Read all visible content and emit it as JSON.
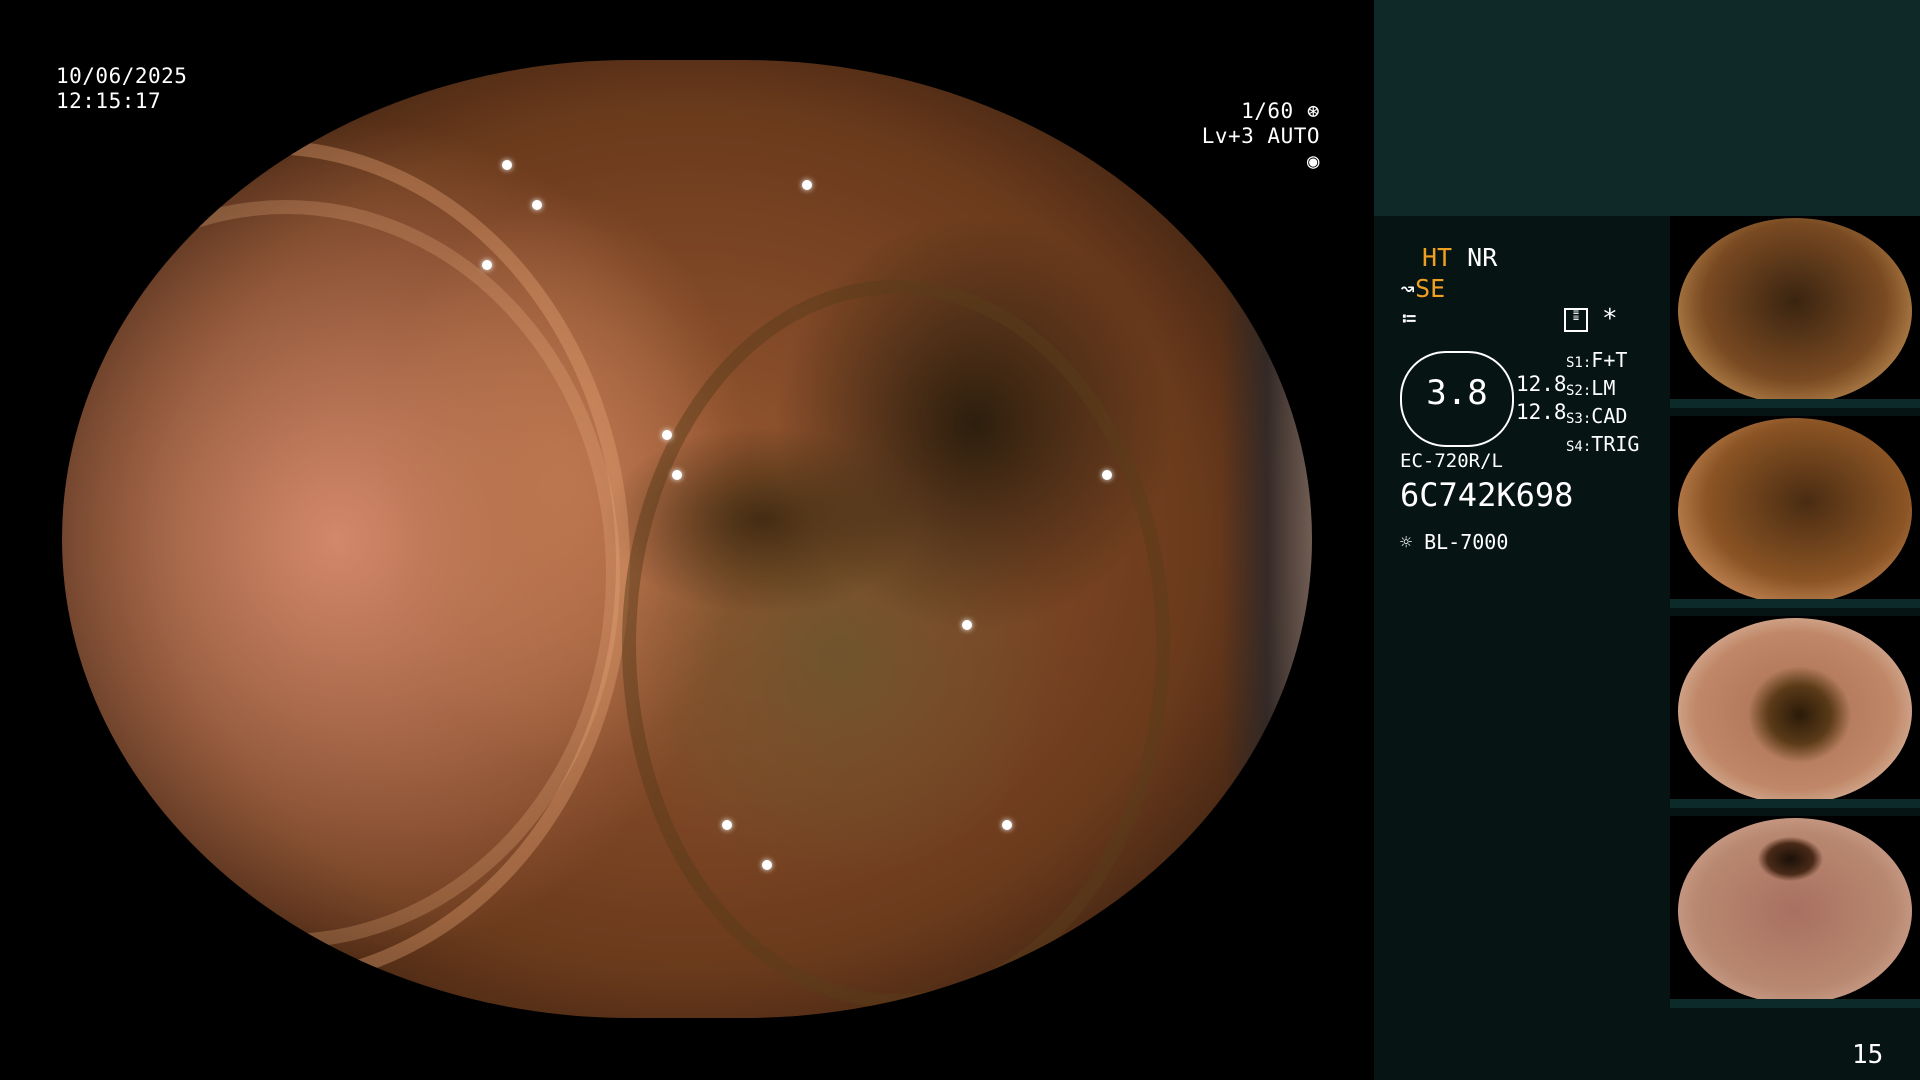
{
  "overlay": {
    "date": "10/06/2025",
    "time": "12:15:17",
    "shutter": "1/60",
    "level": "Lv+3",
    "mode": "AUTO"
  },
  "panel": {
    "ht": "HT",
    "nr": "NR",
    "se": "SE",
    "gauge_value": "3.8",
    "value_a": "12.8",
    "value_b": "12.8",
    "modes": [
      {
        "key": "S1:",
        "label": "F+T"
      },
      {
        "key": "S2:",
        "label": "LM"
      },
      {
        "key": "S3:",
        "label": "CAD"
      },
      {
        "key": "S4:",
        "label": "TRIG"
      }
    ],
    "scope_model": "EC-720R/L",
    "serial": "6C742K698",
    "light_source": "BL-7000",
    "asterisk": "*",
    "page_number": "15"
  },
  "thumbnails": [
    {
      "id": "thumb-1",
      "tone": "#7a4a22"
    },
    {
      "id": "thumb-2",
      "tone": "#8b5424"
    },
    {
      "id": "thumb-3",
      "tone": "#c08868"
    },
    {
      "id": "thumb-4",
      "tone": "#b98870"
    }
  ],
  "colors": {
    "accent": "#f0a020",
    "panel_bg": "#071414",
    "panel_top": "#0f2828"
  },
  "icons": [
    "shutter-icon",
    "auto-iris-icon",
    "structure-enhance-icon",
    "color-mode-icon",
    "settings-card-icon",
    "lamp-icon"
  ]
}
